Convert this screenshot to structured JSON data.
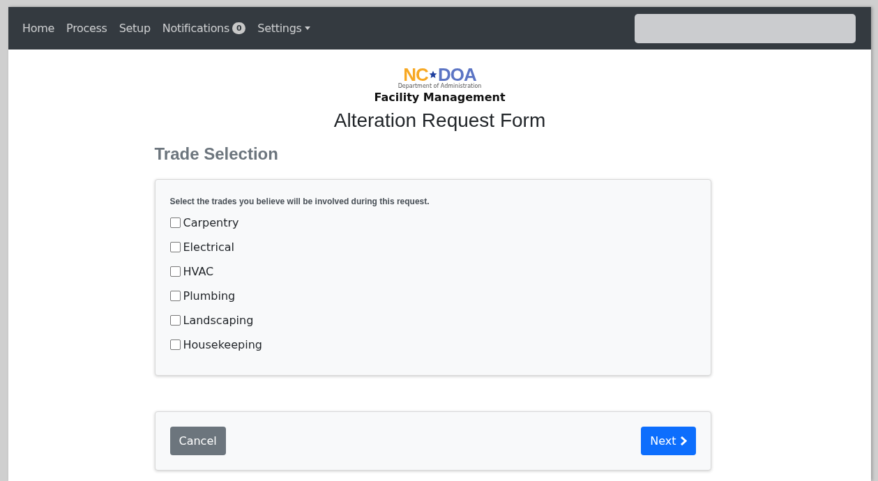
{
  "navbar": {
    "links": [
      {
        "label": "Home"
      },
      {
        "label": "Process"
      },
      {
        "label": "Setup"
      },
      {
        "label": "Notifications",
        "badge": "0"
      },
      {
        "label": "Settings",
        "dropdown": true
      }
    ]
  },
  "logo": {
    "left": "NC",
    "right": "DOA",
    "subtitle": "Department of Administration",
    "division": "Facility Management"
  },
  "page_title": "Alteration Request Form",
  "section_title": "Trade Selection",
  "trades": {
    "instruction": "Select the trades you believe will be involved during this request.",
    "options": [
      {
        "label": "Carpentry",
        "checked": false
      },
      {
        "label": "Electrical",
        "checked": false
      },
      {
        "label": "HVAC",
        "checked": false
      },
      {
        "label": "Plumbing",
        "checked": false
      },
      {
        "label": "Landscaping",
        "checked": false
      },
      {
        "label": "Housekeeping",
        "checked": false
      }
    ]
  },
  "buttons": {
    "cancel": "Cancel",
    "next": "Next"
  }
}
